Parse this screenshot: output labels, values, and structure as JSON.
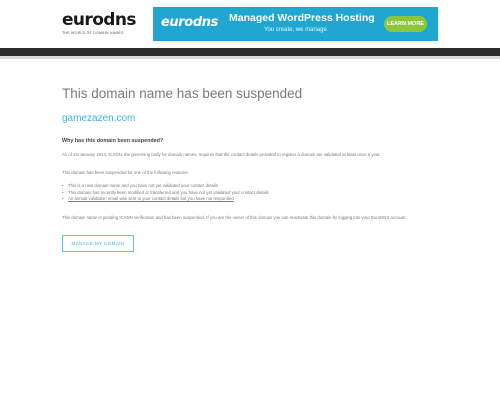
{
  "header": {
    "logo": {
      "name": "eurodns",
      "tagline": "THE WORLD OF DOMAIN NAMES"
    },
    "banner": {
      "brand": "eurodns",
      "title": "Managed WordPress Hosting",
      "subtitle": "You create, we manage",
      "button_label": "LEARN MORE"
    }
  },
  "main": {
    "title": "This domain name has been suspended",
    "domain": "gamezazen.com",
    "question": "Why has this domain been suspended?",
    "paragraph1": "As of 1st January 2014, ICANN, the governing body for domain names, requires that the contact details provided to register a domain are validated at least once a year.",
    "paragraph2": "This domain has been suspended for one of the following reasons:",
    "reasons": [
      "This is a new domain name and you have not yet validated your contact details",
      "This domain has recently been modified or transferred and you have not yet validated your contact details",
      "An annual validation email was sent to your contact details but you have not responded"
    ],
    "paragraph3": "This domain name is pending ICANN verification and has been suspended. If you are the owner of this domain you can reactivate this domain by logging into your EuroDNS account.",
    "button_label": "MANAGE MY DOMAIN"
  },
  "colors": {
    "accent": "#3fb4df",
    "banner_bg": "#1fa7d2",
    "banner_button": "#8cc63f",
    "topbar": "#2b2b2b"
  }
}
